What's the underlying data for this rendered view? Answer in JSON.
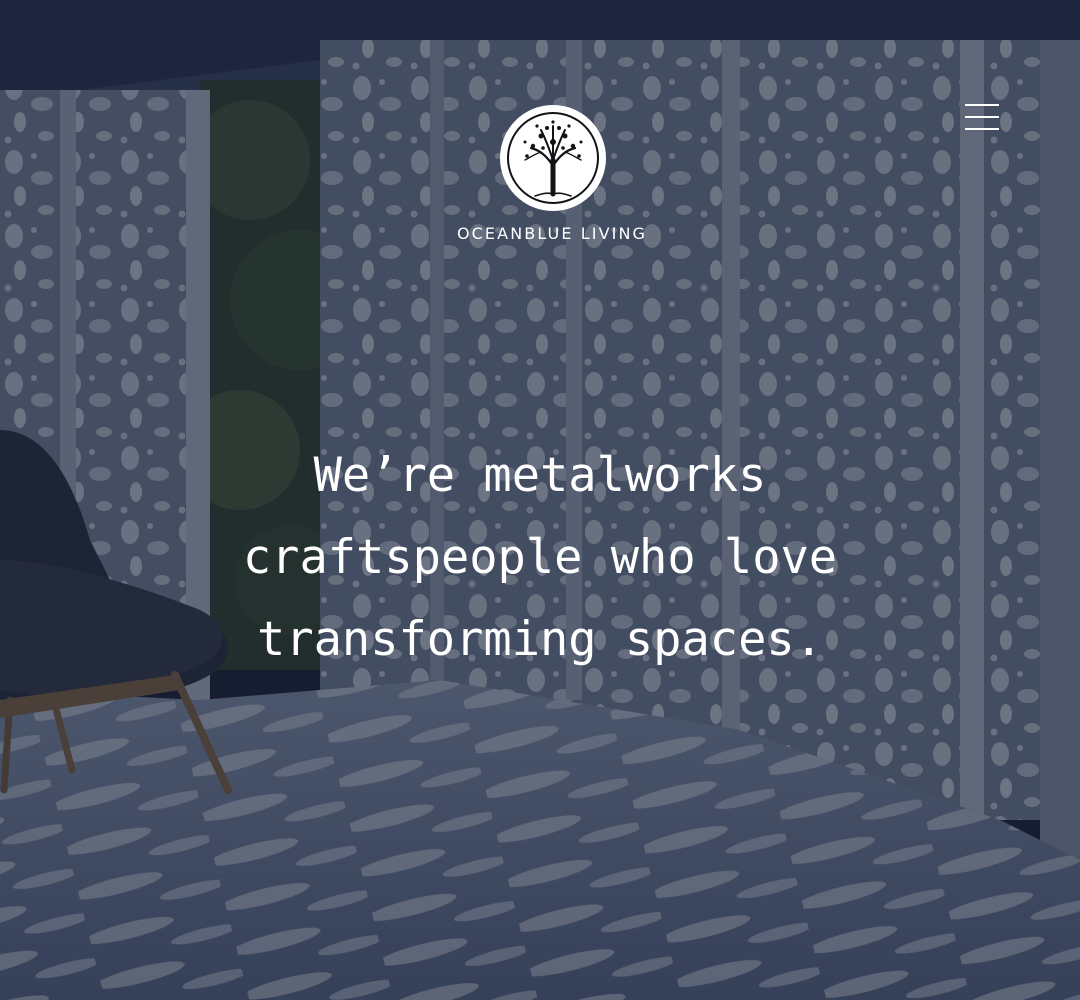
{
  "header": {
    "brand_name": "OCEANBLUE LIVING",
    "logo_icon": "tree-of-life-icon",
    "menu_icon": "hamburger-menu-icon"
  },
  "hero": {
    "tagline": "We’re metalworks\ncraftspeople who love\ntransforming spaces.",
    "overlay_color": "#12182c"
  }
}
